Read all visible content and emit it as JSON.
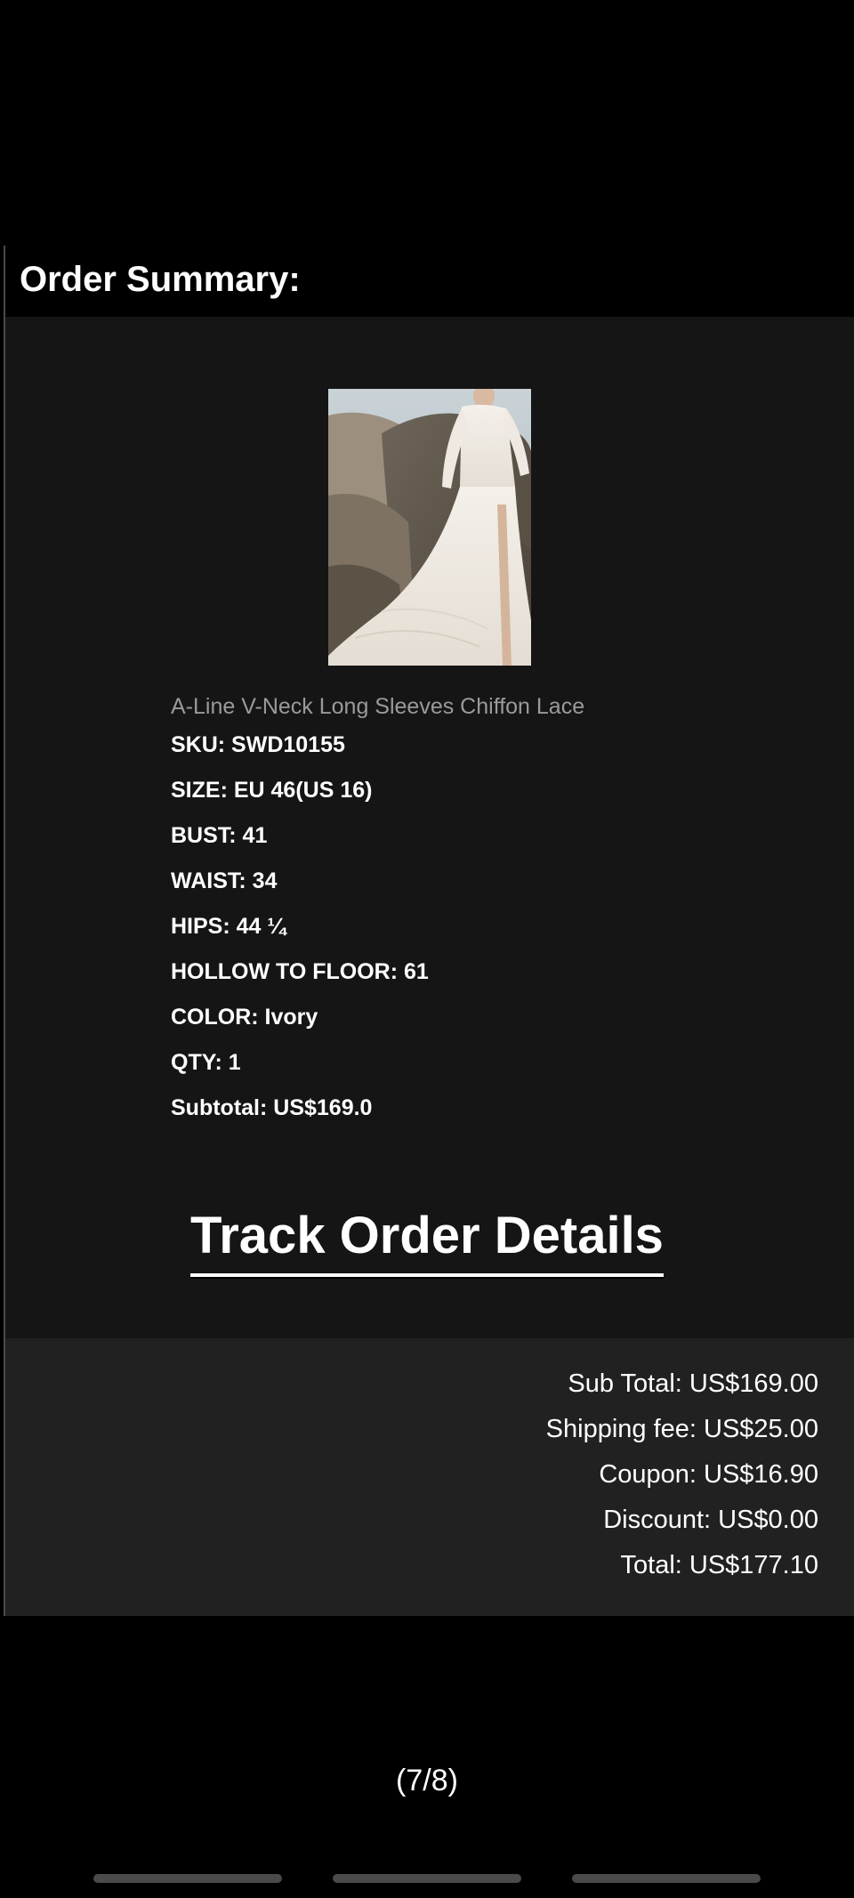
{
  "order_summary": {
    "heading": "Order Summary:"
  },
  "item": {
    "image_alt": "A-Line V-Neck Long Sleeves Chiffon Lace wedding dress",
    "name": "A-Line V-Neck Long Sleeves Chiffon Lace",
    "details": [
      "SKU: SWD10155",
      "SIZE: EU 46(US 16)",
      "BUST: 41",
      "WAIST: 34",
      "HIPS: 44 ¼",
      "HOLLOW TO FLOOR: 61",
      "COLOR: Ivory",
      "QTY: 1",
      "Subtotal: US$169.0"
    ]
  },
  "track_link": {
    "label": "Track Order Details"
  },
  "totals": {
    "sub_total": "Sub Total: US$169.00",
    "shipping_fee": "Shipping fee: US$25.00",
    "coupon": "Coupon: US$16.90",
    "discount": "Discount: US$0.00",
    "total": "Total: US$177.10"
  },
  "pager": {
    "label": "(7/8)"
  },
  "colors": {
    "page_background": "#000000",
    "items_panel": "#151515",
    "totals_panel": "#212121",
    "muted_text": "#9a9a9a",
    "text": "#ffffff"
  }
}
